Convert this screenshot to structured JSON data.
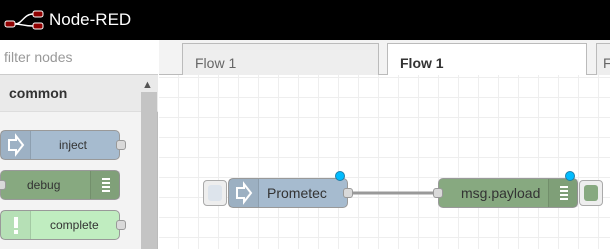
{
  "header": {
    "title": "Node-RED",
    "logo_icon": "node-red-logo-icon",
    "background": "#000000"
  },
  "palette": {
    "filter": {
      "placeholder": "filter nodes",
      "value": ""
    },
    "category": {
      "title": "common",
      "chevron_icon": "chevron-up-icon"
    },
    "nodes": [
      {
        "label": "inject",
        "icon": "arrow-right-icon",
        "color": "#a6bbcf"
      },
      {
        "label": "debug",
        "icon": "list-icon",
        "color": "#87a980"
      },
      {
        "label": "complete",
        "icon": "exclamation-icon",
        "color": "#c0edc0"
      }
    ]
  },
  "tabs": [
    {
      "label": "Flow 1",
      "active": false
    },
    {
      "label": "Flow 1",
      "active": true
    },
    {
      "label": "F",
      "active": false
    }
  ],
  "workspace": {
    "nodes": [
      {
        "label": "Prometec",
        "type": "inject",
        "color": "#a6bbcf",
        "changed": true
      },
      {
        "label": "msg.payload",
        "type": "debug",
        "color": "#87a980",
        "changed": true
      }
    ],
    "wire_color": "#999999"
  }
}
